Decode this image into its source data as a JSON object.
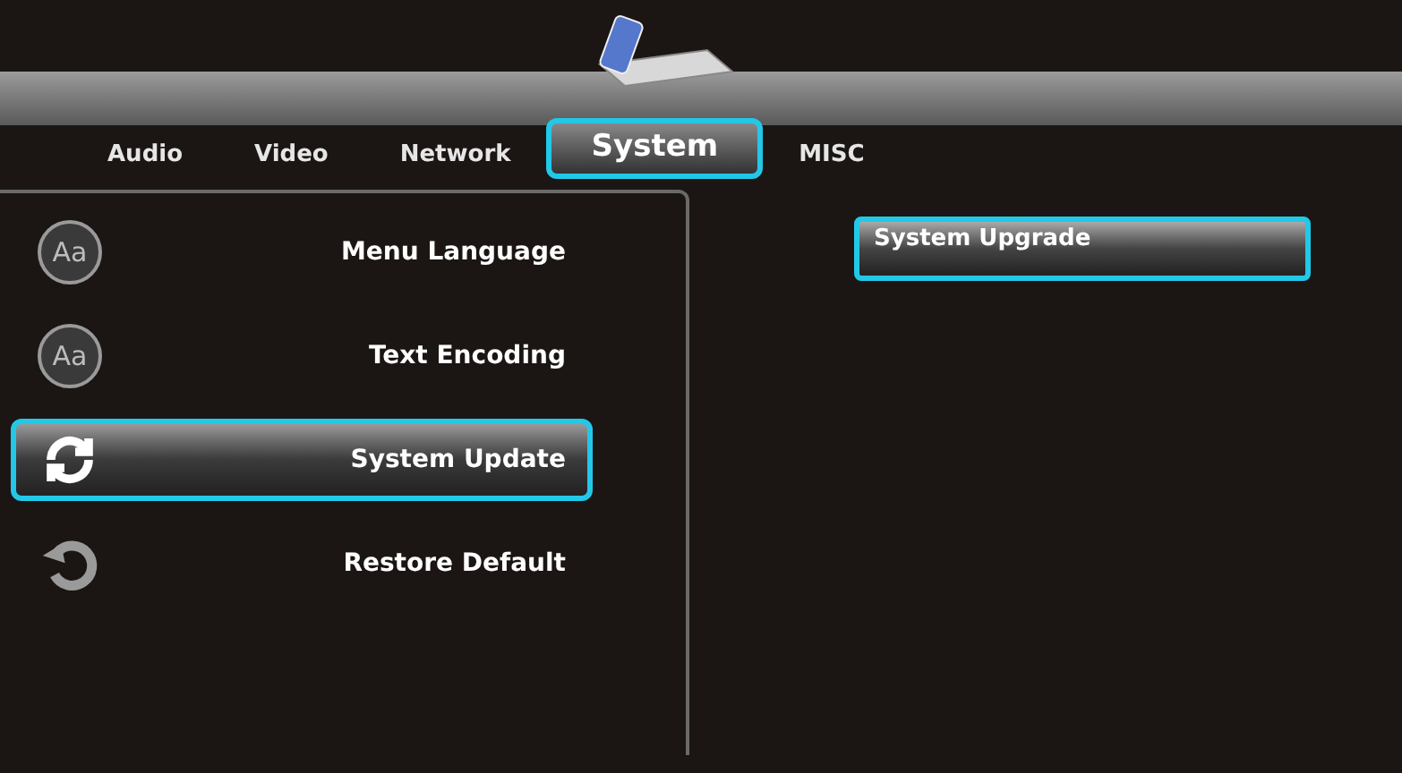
{
  "tabs": [
    {
      "label": "Audio",
      "selected": false
    },
    {
      "label": "Video",
      "selected": false
    },
    {
      "label": "Network",
      "selected": false
    },
    {
      "label": "System",
      "selected": true
    },
    {
      "label": "MISC",
      "selected": false
    }
  ],
  "menu": [
    {
      "label": "Menu Language",
      "kind": "letters",
      "icon_text": "Aa",
      "selected": false
    },
    {
      "label": "Text Encoding",
      "kind": "letters",
      "icon_text": "Aa",
      "selected": false
    },
    {
      "label": "System Update",
      "kind": "sync",
      "selected": true
    },
    {
      "label": "Restore Default",
      "kind": "restore",
      "selected": false
    }
  ],
  "options": [
    {
      "label": "System Upgrade",
      "selected": true
    }
  ]
}
